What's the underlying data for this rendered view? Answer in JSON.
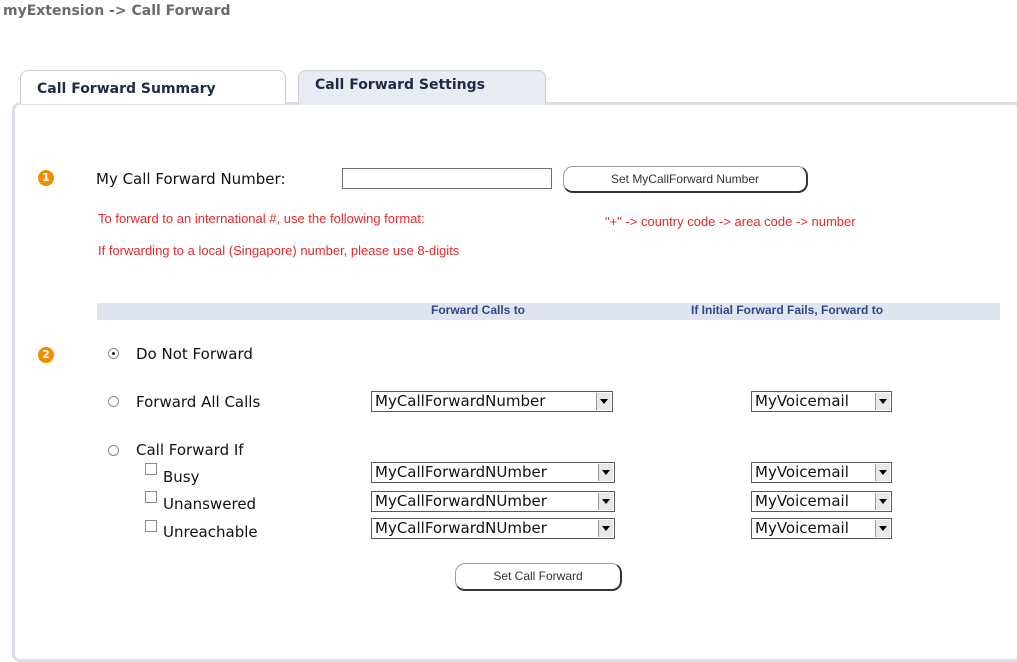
{
  "breadcrumb": "myExtension -> Call Forward",
  "tabs": [
    {
      "label": "Call Forward Summary",
      "active": false
    },
    {
      "label": "Call Forward Settings",
      "active": true
    }
  ],
  "step1": {
    "badge": "1",
    "label": "My Call Forward Number:",
    "number_value": "",
    "set_button": "Set MyCallForward Number",
    "note_intl": "To forward to an international #, use the following format:",
    "note_format": "\"+\" -> country code -> area code -> number",
    "note_local": "If forwarding to a local (Singapore) number, please use 8-digits"
  },
  "table_header": {
    "forward_to": "Forward Calls to",
    "fallback": "If Initial Forward Fails, Forward to"
  },
  "step2": {
    "badge": "2",
    "options": {
      "do_not_forward": "Do Not Forward",
      "forward_all": "Forward  All Calls",
      "forward_if": "Call Forward If"
    },
    "selected_option": "do_not_forward",
    "forward_all_target": "MyCallForwardNumber",
    "forward_all_fallback": "MyVoicemail",
    "conditions": [
      {
        "label": "Busy",
        "checked": false,
        "target": "MyCallForwardNUmber",
        "fallback": "MyVoicemail"
      },
      {
        "label": "Unanswered",
        "checked": false,
        "target": "MyCallForwardNUmber",
        "fallback": "MyVoicemail"
      },
      {
        "label": "Unreachable",
        "checked": false,
        "target": "MyCallForwardNUmber",
        "fallback": "MyVoicemail"
      }
    ],
    "set_button": "Set Call Forward"
  },
  "colors": {
    "badge": "#f28c00",
    "note_red": "#e8282a",
    "header_bar": "#dfe4f0",
    "header_text": "#2b4a86"
  }
}
